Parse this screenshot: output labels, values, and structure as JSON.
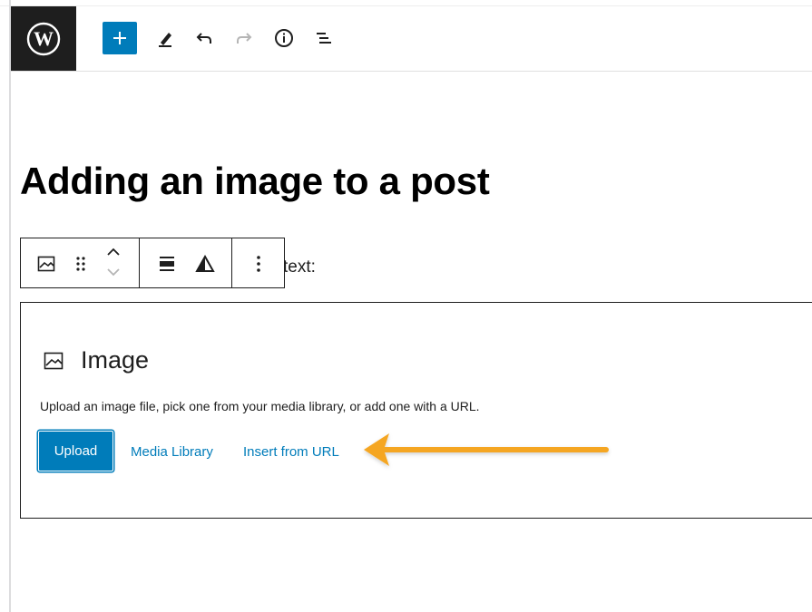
{
  "header": {
    "logo_icon": "wordpress-logo-icon",
    "add_block_icon": "plus-icon",
    "tools": [
      {
        "icon": "pencil-icon"
      },
      {
        "icon": "undo-icon"
      },
      {
        "icon": "redo-icon"
      },
      {
        "icon": "info-icon"
      },
      {
        "icon": "list-view-icon"
      }
    ]
  },
  "post": {
    "title": "Adding an image to a post",
    "paragraph_visible_tail": "text:"
  },
  "block_toolbar": {
    "icons": [
      "image-block-icon",
      "drag-handle-icon",
      "move-up-icon",
      "move-down-icon",
      "align-icon",
      "contrast-icon",
      "more-options-icon"
    ]
  },
  "image_block": {
    "icon": "image-icon",
    "title": "Image",
    "instructions": "Upload an image file, pick one from your media library, or add one with a URL.",
    "upload_label": "Upload",
    "media_library_label": "Media Library",
    "insert_url_label": "Insert from URL"
  },
  "colors": {
    "accent": "#007cba",
    "dark": "#1e1e1e",
    "arrow": "#f5a623"
  }
}
